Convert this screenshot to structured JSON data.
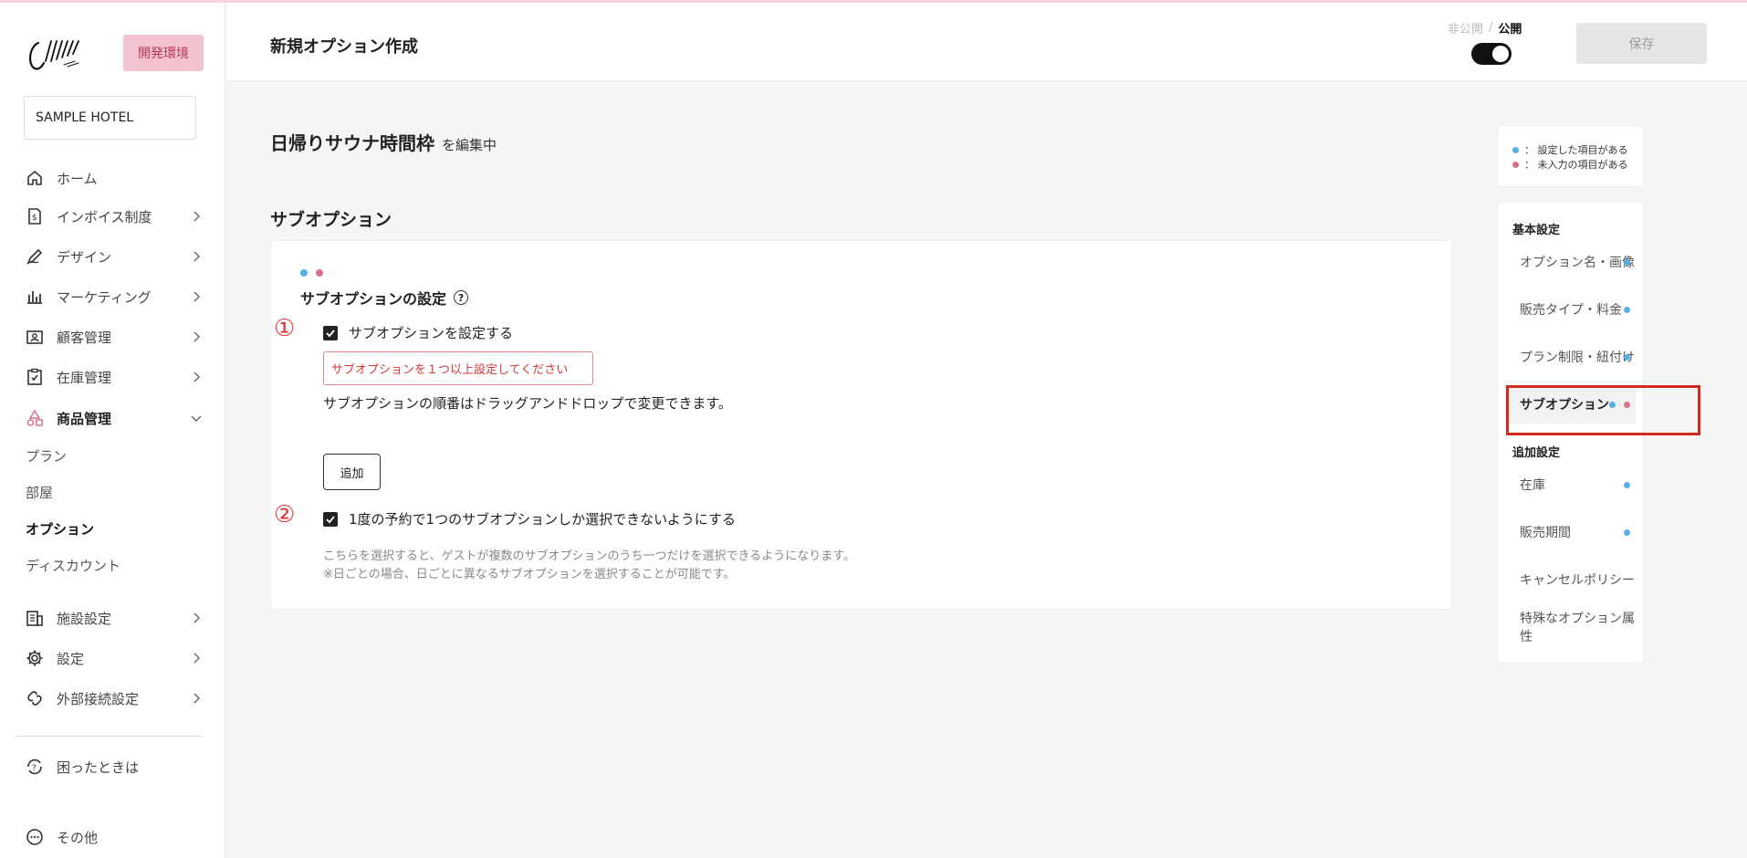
{
  "colors": {
    "blue_dot": "#5aaee6",
    "pink_dot": "#d8718a",
    "error": "#d33a3a",
    "accent_badge": "#f2c3cf"
  },
  "sidebar": {
    "env_badge": "開発環境",
    "hotel": "SAMPLE HOTEL",
    "items": [
      {
        "label": "ホーム",
        "icon": "home-icon"
      },
      {
        "label": "インボイス制度",
        "icon": "invoice-icon"
      },
      {
        "label": "デザイン",
        "icon": "pen-icon"
      },
      {
        "label": "マーケティング",
        "icon": "chart-icon"
      },
      {
        "label": "顧客管理",
        "icon": "customer-icon"
      },
      {
        "label": "在庫管理",
        "icon": "clipboard-icon"
      },
      {
        "label": "商品管理",
        "icon": "shapes-icon"
      }
    ],
    "sub_items": [
      "プラン",
      "部屋",
      "オプション",
      "ディスカウント"
    ],
    "items2": [
      {
        "label": "施設設定",
        "icon": "building-icon"
      },
      {
        "label": "設定",
        "icon": "gear-icon"
      },
      {
        "label": "外部接続設定",
        "icon": "link-icon"
      }
    ],
    "help": "困ったときは",
    "other": "その他"
  },
  "header": {
    "title": "新規オプション作成",
    "private_label": "非公開",
    "separator": "/",
    "public_label": "公開",
    "save_label": "保存"
  },
  "main": {
    "editing_name": "日帰りサウナ時間枠",
    "editing_suffix": "を編集中",
    "section_title": "サブオプション",
    "card": {
      "title": "サブオプションの設定",
      "help": "?",
      "num1": "①",
      "cb1_label": "サブオプションを設定する",
      "error": "サブオプションを１つ以上設定してください",
      "dnd_text": "サブオプションの順番はドラッグアンドドロップで変更できます。",
      "add_label": "追加",
      "num2": "②",
      "cb2_label": "1度の予約で1つのサブオプションしか選択できないようにする",
      "desc1": "こちらを選択すると、ゲストが複数のサブオプションのうち一つだけを選択できるようになります。",
      "desc2": "※日ごとの場合、日ごとに異なるサブオプションを選択することが可能です。"
    }
  },
  "legend": {
    "set": "：  設定した項目がある",
    "missing": "：  未入力の項目がある"
  },
  "toc": {
    "basic_head": "基本設定",
    "basic": [
      {
        "label": "オプション名・画像"
      },
      {
        "label": "販売タイプ・料金"
      },
      {
        "label": "プラン制限・紐付け"
      },
      {
        "label": "サブオプション"
      }
    ],
    "extra_head": "追加設定",
    "extra": [
      {
        "label": "在庫"
      },
      {
        "label": "販売期間"
      },
      {
        "label": "キャンセルポリシー"
      },
      {
        "label": "特殊なオプション属性"
      }
    ]
  }
}
